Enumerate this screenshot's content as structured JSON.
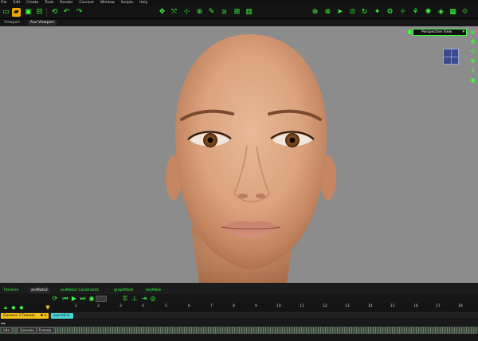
{
  "menu": [
    "File",
    "Edit",
    "Create",
    "Tools",
    "Render",
    "Connect",
    "Window",
    "Scripts",
    "Help"
  ],
  "toolbar_icons_left": [
    "new-icon",
    "open-folder-icon",
    "save-icon",
    "import-icon",
    "refresh-icon",
    "undo-icon",
    "redo-icon"
  ],
  "toolbar_icons_mid": [
    "move-icon",
    "rotate-icon",
    "scale-icon",
    "joint-icon",
    "paint-icon",
    "morph-icon",
    "grid-icon"
  ],
  "toolbar_icons_right": [
    "camera-icon",
    "target-icon",
    "select-icon",
    "pose-icon",
    "rotate-view-icon",
    "figure-icon",
    "bone-icon",
    "morph-brush-icon",
    "light-icon",
    "render-icon",
    "export-icon",
    "settings-icon"
  ],
  "viewport_tabs": [
    "Viewport",
    "Aux Viewport"
  ],
  "viewport": {
    "camera_label": "Perspective View",
    "accent": "#3cff3c",
    "background": "#8c8c8c"
  },
  "bottom_tabs": [
    "Timeline",
    "aniMate2",
    "aniMate2 Constraints",
    "graphMate",
    "keyMate"
  ],
  "ruler_ticks": [
    "1",
    "2",
    "3",
    "4",
    "5",
    "6",
    "7",
    "8",
    "9",
    "10",
    "11",
    "12",
    "13",
    "14",
    "15",
    "16",
    "17",
    "18"
  ],
  "tracks": {
    "figure_pill": "Genesis 3 Female",
    "clip_pill": "eye-blink",
    "row3_label_a": "idle",
    "row3_label_b": "Genesis 3 Female",
    "figure_pill_color": "#f4c21a",
    "clip_pill_color": "#4fd4d8"
  }
}
